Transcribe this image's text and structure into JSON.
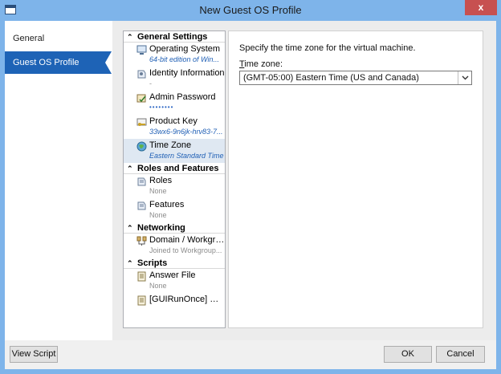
{
  "window": {
    "title": "New Guest OS Profile",
    "close_label": "x"
  },
  "leftnav": {
    "items": [
      {
        "label": "General",
        "selected": false
      },
      {
        "label": "Guest OS Profile",
        "selected": true
      }
    ]
  },
  "tree": {
    "groups": [
      {
        "title": "General Settings",
        "entries": [
          {
            "label": "Operating System",
            "sub": "64-bit edition of Win...",
            "icon": "os-icon"
          },
          {
            "label": "Identity Information",
            "sub": "-",
            "icon": "identity-icon"
          },
          {
            "label": "Admin Password",
            "sub": "••••••••",
            "icon": "password-icon"
          },
          {
            "label": "Product Key",
            "sub": "33wx6-9n6jk-hrv83-7...",
            "icon": "key-icon"
          },
          {
            "label": "Time Zone",
            "sub": "Eastern Standard Time",
            "icon": "globe-icon"
          }
        ]
      },
      {
        "title": "Roles and Features",
        "entries": [
          {
            "label": "Roles",
            "sub": "None",
            "icon": "roles-icon"
          },
          {
            "label": "Features",
            "sub": "None",
            "icon": "features-icon"
          }
        ]
      },
      {
        "title": "Networking",
        "entries": [
          {
            "label": "Domain / Workgro...",
            "sub": "Joined to Workgroup...",
            "icon": "network-icon"
          }
        ]
      },
      {
        "title": "Scripts",
        "entries": [
          {
            "label": "Answer File",
            "sub": "None",
            "icon": "answer-file-icon"
          },
          {
            "label": "[GUIRunOnce] Co...",
            "sub": "",
            "icon": "script-icon"
          }
        ]
      }
    ]
  },
  "panel": {
    "description": "Specify the time zone for the virtual machine.",
    "timezone_label_prefix": "T",
    "timezone_label_rest": "ime zone:",
    "timezone_value": "(GMT-05:00) Eastern Time (US and Canada)"
  },
  "footer": {
    "view_script": "View Script",
    "ok": "OK",
    "cancel": "Cancel"
  },
  "colors": {
    "titlebar": "#7eb4ea",
    "nav_selected": "#1e63b6",
    "close_button": "#c75050"
  }
}
